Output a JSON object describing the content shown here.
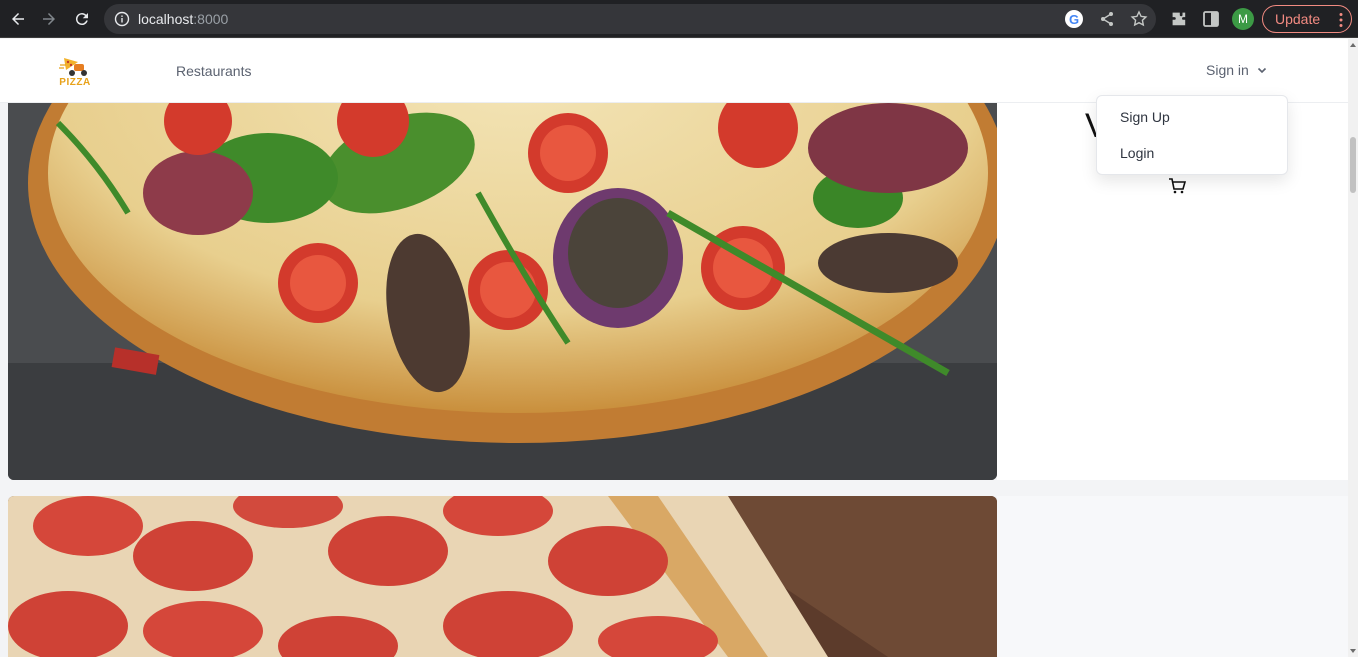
{
  "browser": {
    "url_host": "localhost",
    "url_port": ":8000",
    "avatar_letter": "M",
    "update_label": "Update",
    "icons": [
      "back-icon",
      "forward-icon",
      "reload-icon",
      "info-icon",
      "google-icon",
      "share-icon",
      "star-icon",
      "extensions-icon",
      "side-panel-icon",
      "menu-icon"
    ]
  },
  "header": {
    "logo_text": "PIZZA",
    "nav_link": "Restaurants",
    "signin_label": "Sign in"
  },
  "dropdown": {
    "items": [
      {
        "label": "Sign Up"
      },
      {
        "label": "Login"
      }
    ]
  },
  "sidebar": {
    "partial_title": "V",
    "icon": "cart-icon"
  },
  "colors": {
    "chrome_bg": "#202124",
    "update_accent": "#f28b82",
    "logo_accent": "#e8a21a",
    "avatar": "#3c9a45"
  }
}
